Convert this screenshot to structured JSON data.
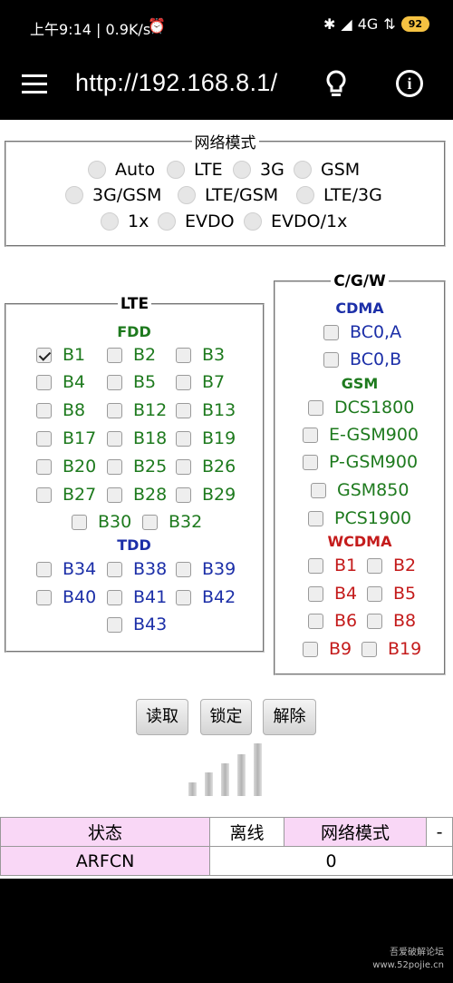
{
  "status_bar": {
    "left": "上午9:14 | 0.9K/s",
    "network": "4G",
    "battery": "92"
  },
  "app_bar": {
    "url": "http://192.168.8.1/"
  },
  "network_mode": {
    "legend": "网络模式",
    "options": [
      "Auto",
      "LTE",
      "3G",
      "GSM",
      "3G/GSM",
      "LTE/GSM",
      "LTE/3G",
      "1x",
      "EVDO",
      "EVDO/1x"
    ]
  },
  "lte": {
    "legend": "LTE",
    "fdd_header": "FDD",
    "fdd_bands": [
      "B1",
      "B2",
      "B3",
      "B4",
      "B5",
      "B7",
      "B8",
      "B12",
      "B13",
      "B17",
      "B18",
      "B19",
      "B20",
      "B25",
      "B26",
      "B27",
      "B28",
      "B29",
      "B30",
      "B32"
    ],
    "fdd_checked": [
      "B1"
    ],
    "tdd_header": "TDD",
    "tdd_bands": [
      "B34",
      "B38",
      "B39",
      "B40",
      "B41",
      "B42",
      "B43"
    ]
  },
  "cgw": {
    "legend": "C/G/W",
    "cdma_header": "CDMA",
    "cdma_bands": [
      "BC0,A",
      "BC0,B"
    ],
    "gsm_header": "GSM",
    "gsm_bands": [
      "DCS1800",
      "E-GSM900",
      "P-GSM900",
      "GSM850",
      "PCS1900"
    ],
    "wcdma_header": "WCDMA",
    "wcdma_bands": [
      "B1",
      "B2",
      "B4",
      "B5",
      "B6",
      "B8",
      "B9",
      "B19"
    ]
  },
  "buttons": {
    "read": "读取",
    "lock": "锁定",
    "unlock": "解除"
  },
  "status_table": {
    "row1": {
      "label": "状态",
      "value": "离线",
      "mode_label": "网络模式",
      "mode_value": "-"
    },
    "row2": {
      "label": "ARFCN",
      "value": "0"
    }
  },
  "watermark": {
    "line1": "吾爱破解论坛",
    "line2": "www.52pojie.cn"
  },
  "colors": {
    "green": "#1e7a1e",
    "blue": "#1c2fa8",
    "red": "#c41b1b",
    "table_pink": "#f9d7f6",
    "battery": "#f5c242"
  }
}
